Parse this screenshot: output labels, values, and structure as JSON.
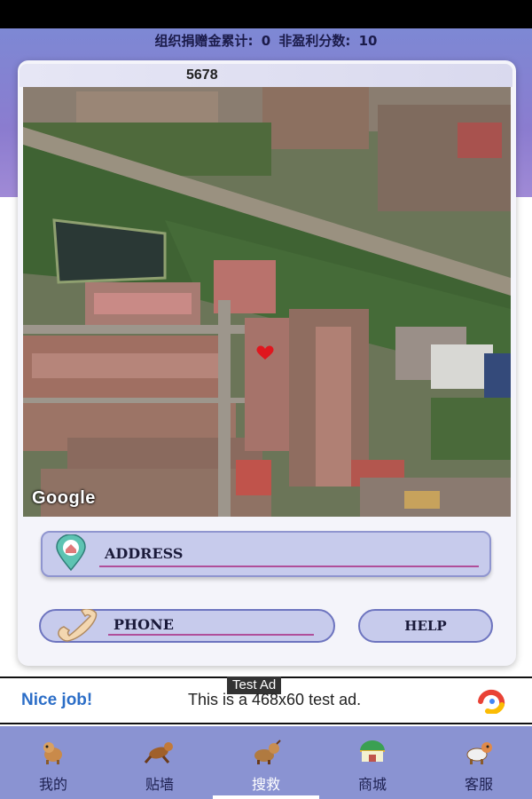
{
  "summary": {
    "donation_label": "组织捐赠金累计:",
    "donation_value": "0",
    "score_label": "非盈利分数:",
    "score_value": "10"
  },
  "case": {
    "id": "5678"
  },
  "map": {
    "attribution": "Google",
    "marker_icon": "heart-icon"
  },
  "address": {
    "label": "ADDRESS",
    "icon": "location-pin-icon"
  },
  "phone": {
    "label": "PHONE",
    "icon": "phone-handset-icon"
  },
  "help": {
    "label": "HELP"
  },
  "ad": {
    "tag": "Test Ad",
    "nice": "Nice job!",
    "text": "This is a 468x60 test ad.",
    "logo_icon": "ad-logo-icon"
  },
  "nav": {
    "items": [
      {
        "label": "我的",
        "icon": "dog-icon",
        "active": false
      },
      {
        "label": "贴墙",
        "icon": "running-dog-icon",
        "active": false
      },
      {
        "label": "搜救",
        "icon": "dog-search-icon",
        "active": true
      },
      {
        "label": "商城",
        "icon": "shop-icon",
        "active": false
      },
      {
        "label": "客服",
        "icon": "dog-service-icon",
        "active": false
      }
    ]
  },
  "colors": {
    "accent": "#8a93d2",
    "hero": "#7d88d4",
    "button_fill": "#c7cbec",
    "underline": "#b04e9a",
    "marker": "#e0161e"
  }
}
